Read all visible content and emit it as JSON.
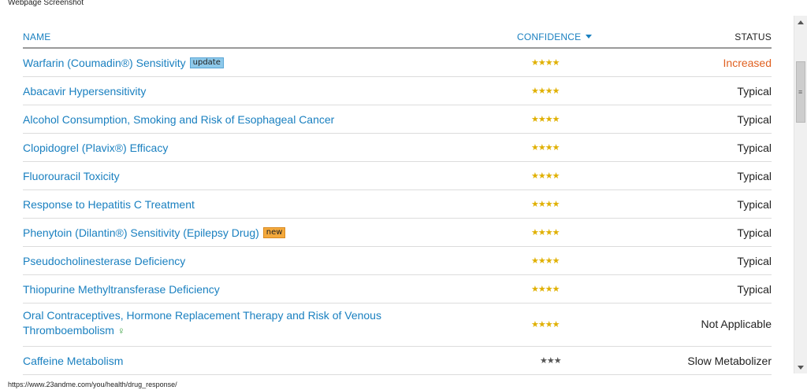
{
  "window": {
    "title": "Webpage Screenshot"
  },
  "table": {
    "headers": {
      "name": "NAME",
      "confidence": "CONFIDENCE",
      "status": "STATUS"
    },
    "rows": [
      {
        "name": "Warfarin (Coumadin®) Sensitivity",
        "badge": "update",
        "stars": "★★★★",
        "status": "Increased"
      },
      {
        "name": "Abacavir Hypersensitivity",
        "stars": "★★★★",
        "status": "Typical"
      },
      {
        "name": "Alcohol Consumption, Smoking and Risk of Esophageal Cancer",
        "stars": "★★★★",
        "status": "Typical"
      },
      {
        "name": "Clopidogrel (Plavix®) Efficacy",
        "stars": "★★★★",
        "status": "Typical"
      },
      {
        "name": "Fluorouracil Toxicity",
        "stars": "★★★★",
        "status": "Typical"
      },
      {
        "name": "Response to Hepatitis C Treatment",
        "stars": "★★★★",
        "status": "Typical"
      },
      {
        "name": "Phenytoin (Dilantin®) Sensitivity (Epilepsy Drug)",
        "badge": "new",
        "stars": "★★★★",
        "status": "Typical"
      },
      {
        "name": "Pseudocholinesterase Deficiency",
        "stars": "★★★★",
        "status": "Typical"
      },
      {
        "name": "Thiopurine Methyltransferase Deficiency",
        "stars": "★★★★",
        "status": "Typical"
      },
      {
        "name": "Oral Contraceptives, Hormone Replacement Therapy and Risk of Venous Thromboembolism",
        "icon_glyph": "♀",
        "stars": "★★★★",
        "status": "Not Applicable"
      },
      {
        "name": "Caffeine Metabolism",
        "stars": "★★★",
        "status": "Slow Metabolizer"
      }
    ]
  },
  "status_bar": {
    "url": "https://www.23andme.com/you/health/drug_response/"
  }
}
